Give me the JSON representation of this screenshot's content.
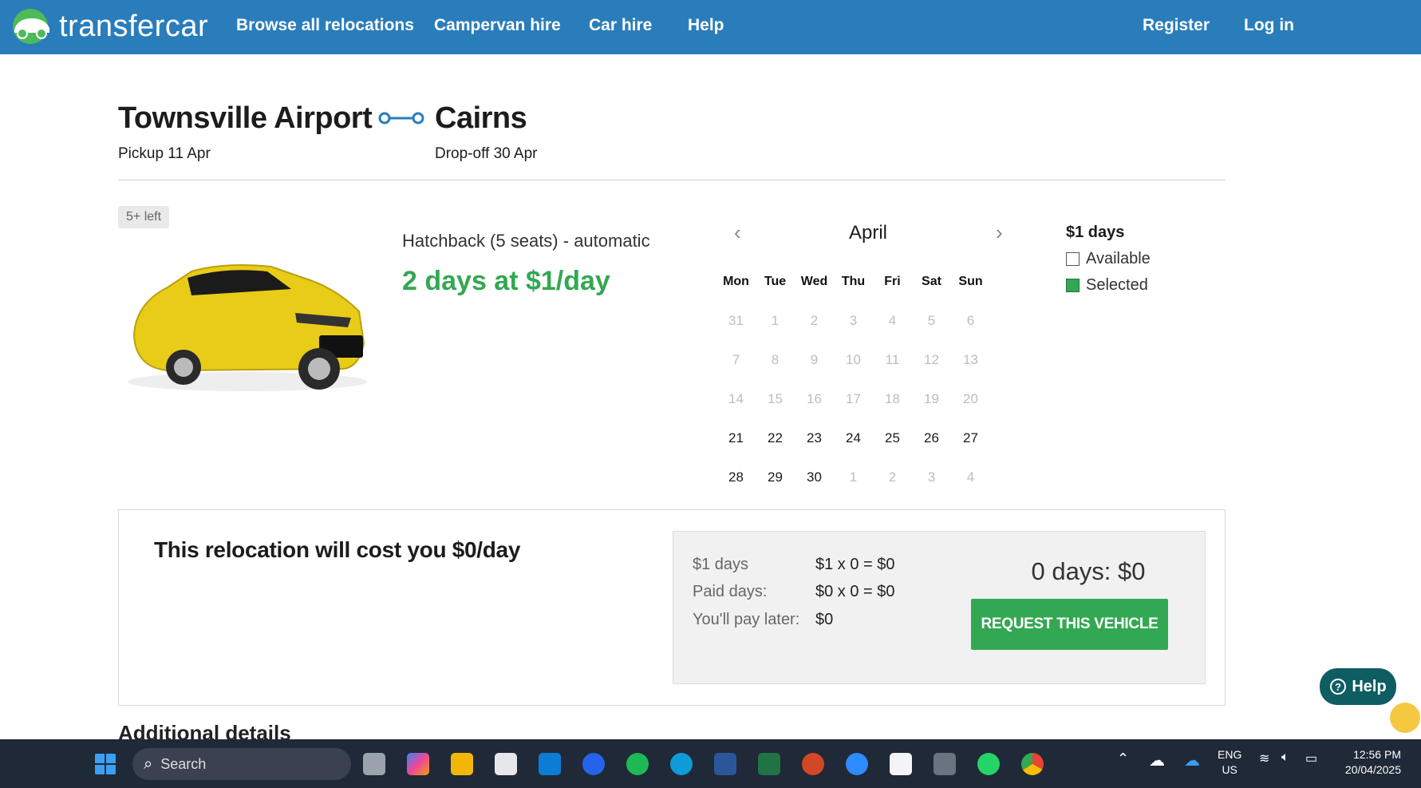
{
  "nav": {
    "brand": "transfercar",
    "links": [
      "Browse all relocations",
      "Campervan hire",
      "Car hire",
      "Help"
    ],
    "register": "Register",
    "login": "Log in"
  },
  "trip": {
    "origin": "Townsville Airport",
    "destination": "Cairns",
    "pickup": "Pickup 11 Apr",
    "dropoff": "Drop-off 30 Apr"
  },
  "vehicle": {
    "badge": "5+ left",
    "title": "Hatchback (5 seats) - automatic",
    "price": "2 days at $1/day",
    "image_alt": "yellow-hatchback"
  },
  "calendar": {
    "month": "April",
    "days": [
      "Mon",
      "Tue",
      "Wed",
      "Thu",
      "Fri",
      "Sat",
      "Sun"
    ],
    "weeks": [
      [
        {
          "d": "31",
          "m": 1
        },
        {
          "d": "1",
          "m": 1
        },
        {
          "d": "2",
          "m": 1
        },
        {
          "d": "3",
          "m": 1
        },
        {
          "d": "4",
          "m": 1
        },
        {
          "d": "5",
          "m": 1
        },
        {
          "d": "6",
          "m": 1
        }
      ],
      [
        {
          "d": "7",
          "m": 1
        },
        {
          "d": "8",
          "m": 1
        },
        {
          "d": "9",
          "m": 1
        },
        {
          "d": "10",
          "m": 1
        },
        {
          "d": "11",
          "m": 1
        },
        {
          "d": "12",
          "m": 1
        },
        {
          "d": "13",
          "m": 1
        }
      ],
      [
        {
          "d": "14",
          "m": 1
        },
        {
          "d": "15",
          "m": 1
        },
        {
          "d": "16",
          "m": 1
        },
        {
          "d": "17",
          "m": 1
        },
        {
          "d": "18",
          "m": 1
        },
        {
          "d": "19",
          "m": 1
        },
        {
          "d": "20",
          "m": 1
        }
      ],
      [
        {
          "d": "21",
          "m": 0
        },
        {
          "d": "22",
          "m": 0
        },
        {
          "d": "23",
          "m": 0
        },
        {
          "d": "24",
          "m": 0
        },
        {
          "d": "25",
          "m": 0
        },
        {
          "d": "26",
          "m": 0
        },
        {
          "d": "27",
          "m": 0
        }
      ],
      [
        {
          "d": "28",
          "m": 0
        },
        {
          "d": "29",
          "m": 0
        },
        {
          "d": "30",
          "m": 0
        },
        {
          "d": "1",
          "m": 1
        },
        {
          "d": "2",
          "m": 1
        },
        {
          "d": "3",
          "m": 1
        },
        {
          "d": "4",
          "m": 1
        }
      ]
    ]
  },
  "legend": {
    "title": "$1 days",
    "available": "Available",
    "selected": "Selected"
  },
  "cost": {
    "headline": "This relocation will cost you $0/day",
    "rows": [
      {
        "label": "$1 days",
        "value": "$1 x 0 = $0"
      },
      {
        "label": "Paid days:",
        "value": "$0 x 0 = $0"
      },
      {
        "label": "You'll pay later:",
        "value": "$0"
      }
    ],
    "total": "0 days: $0",
    "cta": "REQUEST THIS VEHICLE"
  },
  "help_button": "Help",
  "additional": "Additional details",
  "taskbar": {
    "search_placeholder": "Search",
    "lang": "ENG",
    "region": "US",
    "time": "12:56 PM",
    "date": "20/04/2025"
  },
  "colors": {
    "nav": "#2a7dbb",
    "accent_green": "#33a852",
    "help_teal": "#0d5d63"
  }
}
